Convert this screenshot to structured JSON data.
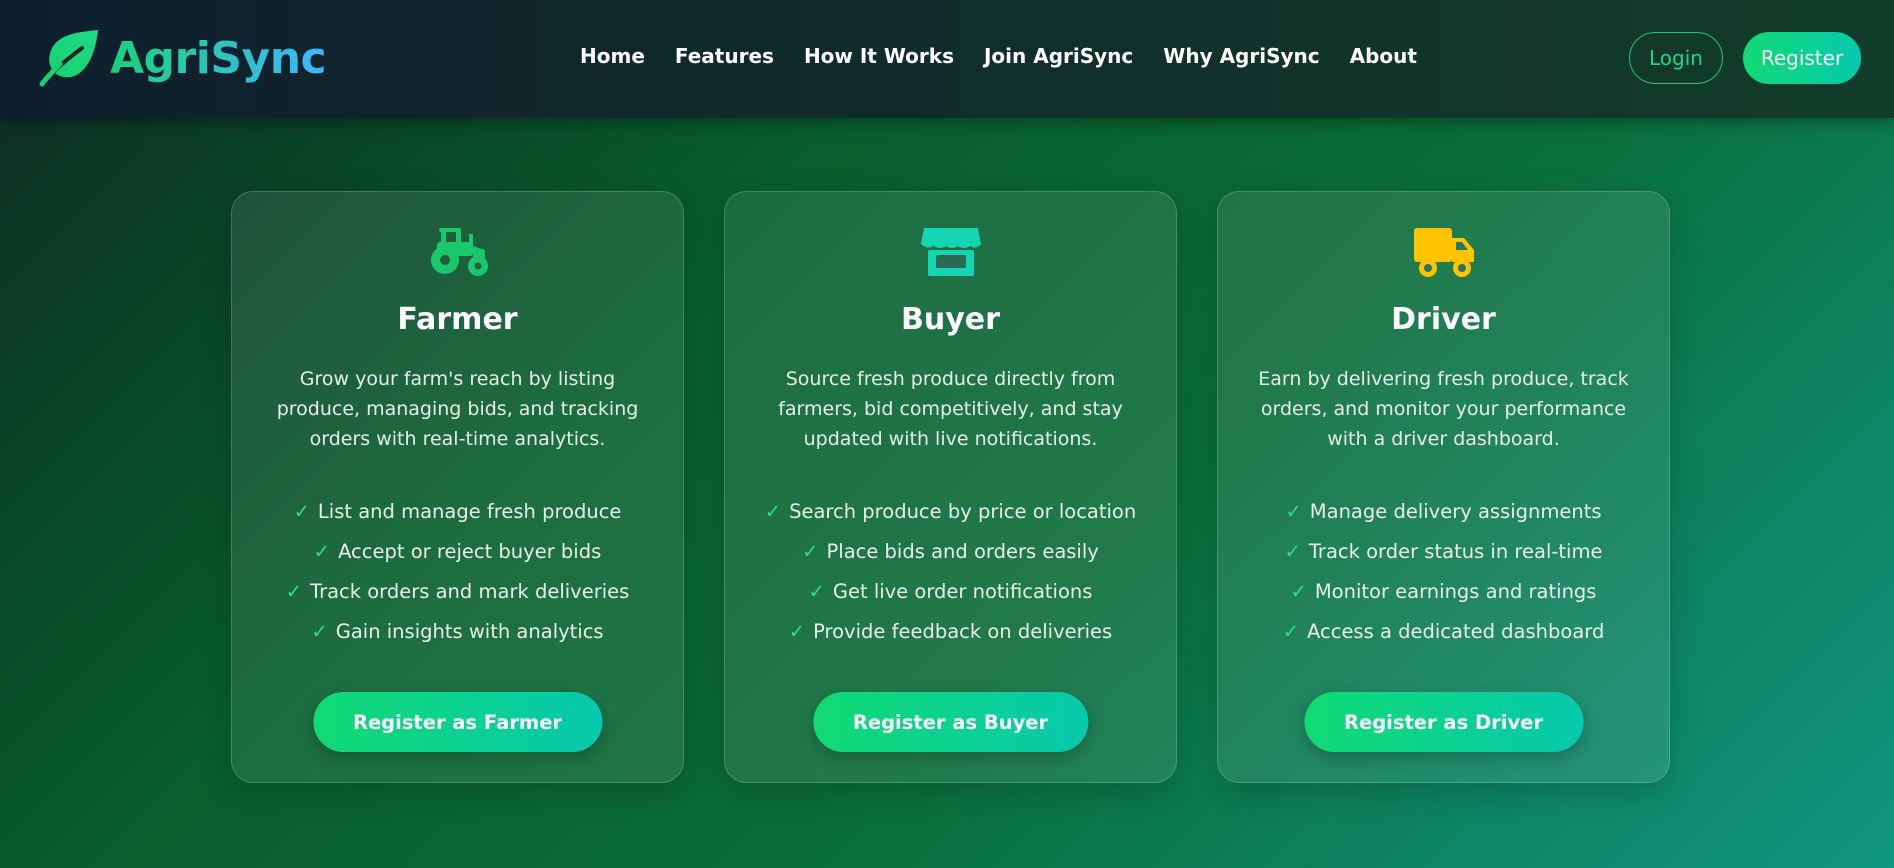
{
  "brand": {
    "name": "AgriSync",
    "icon": "leaf-icon"
  },
  "nav": {
    "links": [
      "Home",
      "Features",
      "How It Works",
      "Join AgriSync",
      "Why AgriSync",
      "About"
    ],
    "login_label": "Login",
    "register_label": "Register"
  },
  "colors": {
    "accent_green": "#10da72",
    "accent_teal": "#07c9ae",
    "check_green": "#2de07f",
    "buyer_icon": "#14d6b4",
    "driver_icon": "#ffc300",
    "farmer_icon": "#18c96b"
  },
  "roles": [
    {
      "icon": "tractor-icon",
      "title": "Farmer",
      "description": "Grow your farm's reach by listing produce, managing bids, and tracking orders with real-time analytics.",
      "features": [
        "List and manage fresh produce",
        "Accept or reject buyer bids",
        "Track orders and mark deliveries",
        "Gain insights with analytics"
      ],
      "button": "Register as Farmer"
    },
    {
      "icon": "store-icon",
      "title": "Buyer",
      "description": "Source fresh produce directly from farmers, bid competitively, and stay updated with live notifications.",
      "features": [
        "Search produce by price or location",
        "Place bids and orders easily",
        "Get live order notifications",
        "Provide feedback on deliveries"
      ],
      "button": "Register as Buyer"
    },
    {
      "icon": "truck-icon",
      "title": "Driver",
      "description": "Earn by delivering fresh produce, track orders, and monitor your performance with a driver dashboard.",
      "features": [
        "Manage delivery assignments",
        "Track order status in real-time",
        "Monitor earnings and ratings",
        "Access a dedicated dashboard"
      ],
      "button": "Register as Driver"
    }
  ]
}
